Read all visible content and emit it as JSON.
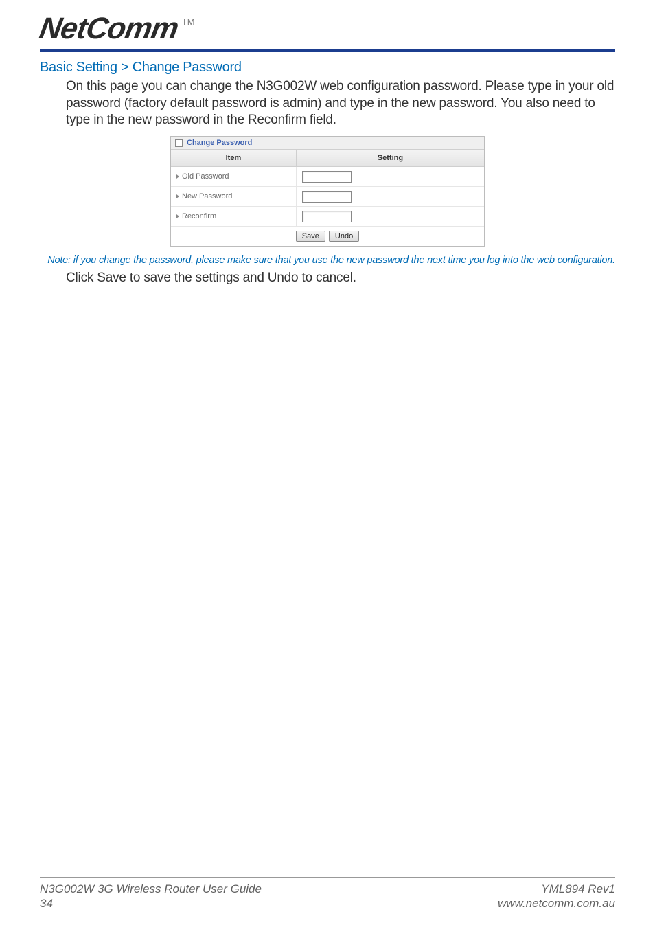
{
  "header": {
    "logo_text": "NetComm",
    "tm": "TM"
  },
  "section": {
    "title": "Basic Setting > Change Password",
    "intro": "On this page you can change the N3G002W web configuration password. Please type in your old password (factory default password is admin) and type in the new password. You also need to type in the new password in the Reconfirm field.",
    "note": "Note: if you change the password, please make sure that you use the new password the next time you log into the web configuration.",
    "closing": "Click Save to save the settings and Undo to cancel."
  },
  "panel": {
    "title": "Change Password",
    "col_item": "Item",
    "col_setting": "Setting",
    "rows": {
      "old": "Old Password",
      "new": "New Password",
      "reconfirm": "Reconfirm"
    },
    "save_label": "Save",
    "undo_label": "Undo"
  },
  "footer": {
    "guide": "N3G002W 3G Wireless Router User Guide",
    "page": "34",
    "rev": "YML894 Rev1",
    "url": "www.netcomm.com.au"
  }
}
